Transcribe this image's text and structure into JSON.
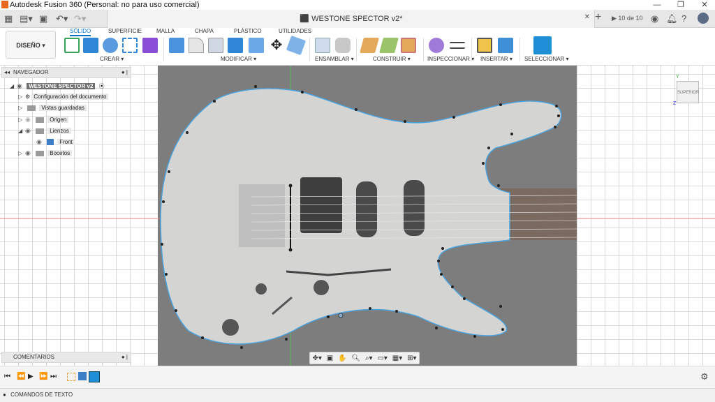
{
  "app": {
    "title": "Autodesk Fusion 360 (Personal: no para uso comercial)",
    "min": "—",
    "max": "❐",
    "close": "✕"
  },
  "tabbar": {
    "doc_title": "WESTONE SPECTOR v2*",
    "close": "✕",
    "plus": "+",
    "jobs": "10 de 10"
  },
  "ribbon": {
    "workspace": "DISEÑO ▾",
    "tabs": [
      "SÓLIDO",
      "SUPERFICIE",
      "MALLA",
      "CHAPA",
      "PLÁSTICO",
      "UTILIDADES"
    ],
    "groups": [
      "CREAR ▾",
      "MODIFICAR ▾",
      "ENSAMBLAR ▾",
      "CONSTRUIR ▾",
      "INSPECCIONAR ▾",
      "INSERTAR ▾",
      "SELECCIONAR ▾"
    ]
  },
  "browser": {
    "header": "NAVEGADOR",
    "root": "WESTONE SPECTOR v2",
    "items": [
      {
        "label": "Configuración del documento"
      },
      {
        "label": "Vistas guardadas"
      },
      {
        "label": "Origen"
      },
      {
        "label": "Lienzos"
      },
      {
        "label": "Front"
      },
      {
        "label": "Bocetos"
      }
    ]
  },
  "viewcube": {
    "label": "SUPERIOR"
  },
  "comments": {
    "label": "COMENTARIOS"
  },
  "textcommands": {
    "label": "COMANDOS DE TEXTO"
  }
}
